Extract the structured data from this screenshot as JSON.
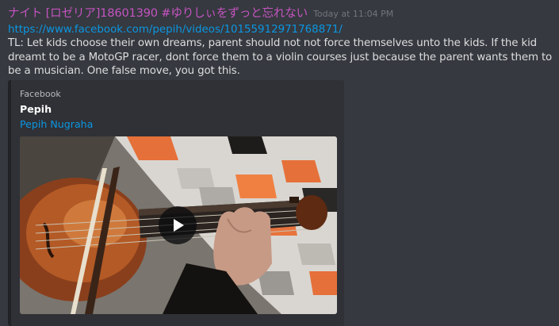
{
  "message": {
    "author": "ナイト [ロゼリア]18601390 #ゆりしぃをずっと忘れない",
    "timestamp": "Today at 11:04 PM",
    "link_text": "https://www.facebook.com/pepih/videos/10155912971768871/",
    "content": "TL: Let kids choose their own dreams, parent should not not force themselves unto the kids. If the kid dreamt to be a MotoGP racer, dont force them to a violin courses just because the parent wants them to be a musician. One false move, you got this."
  },
  "embed": {
    "provider": "Facebook",
    "title": "Pepih",
    "author": "Pepih Nugraha",
    "video": {
      "play_icon": "play-icon"
    }
  },
  "colors": {
    "background": "#36393f",
    "username": "#c554c2",
    "link": "#0b96e3",
    "embed_background": "#2f3136",
    "text": "#dcddde"
  }
}
